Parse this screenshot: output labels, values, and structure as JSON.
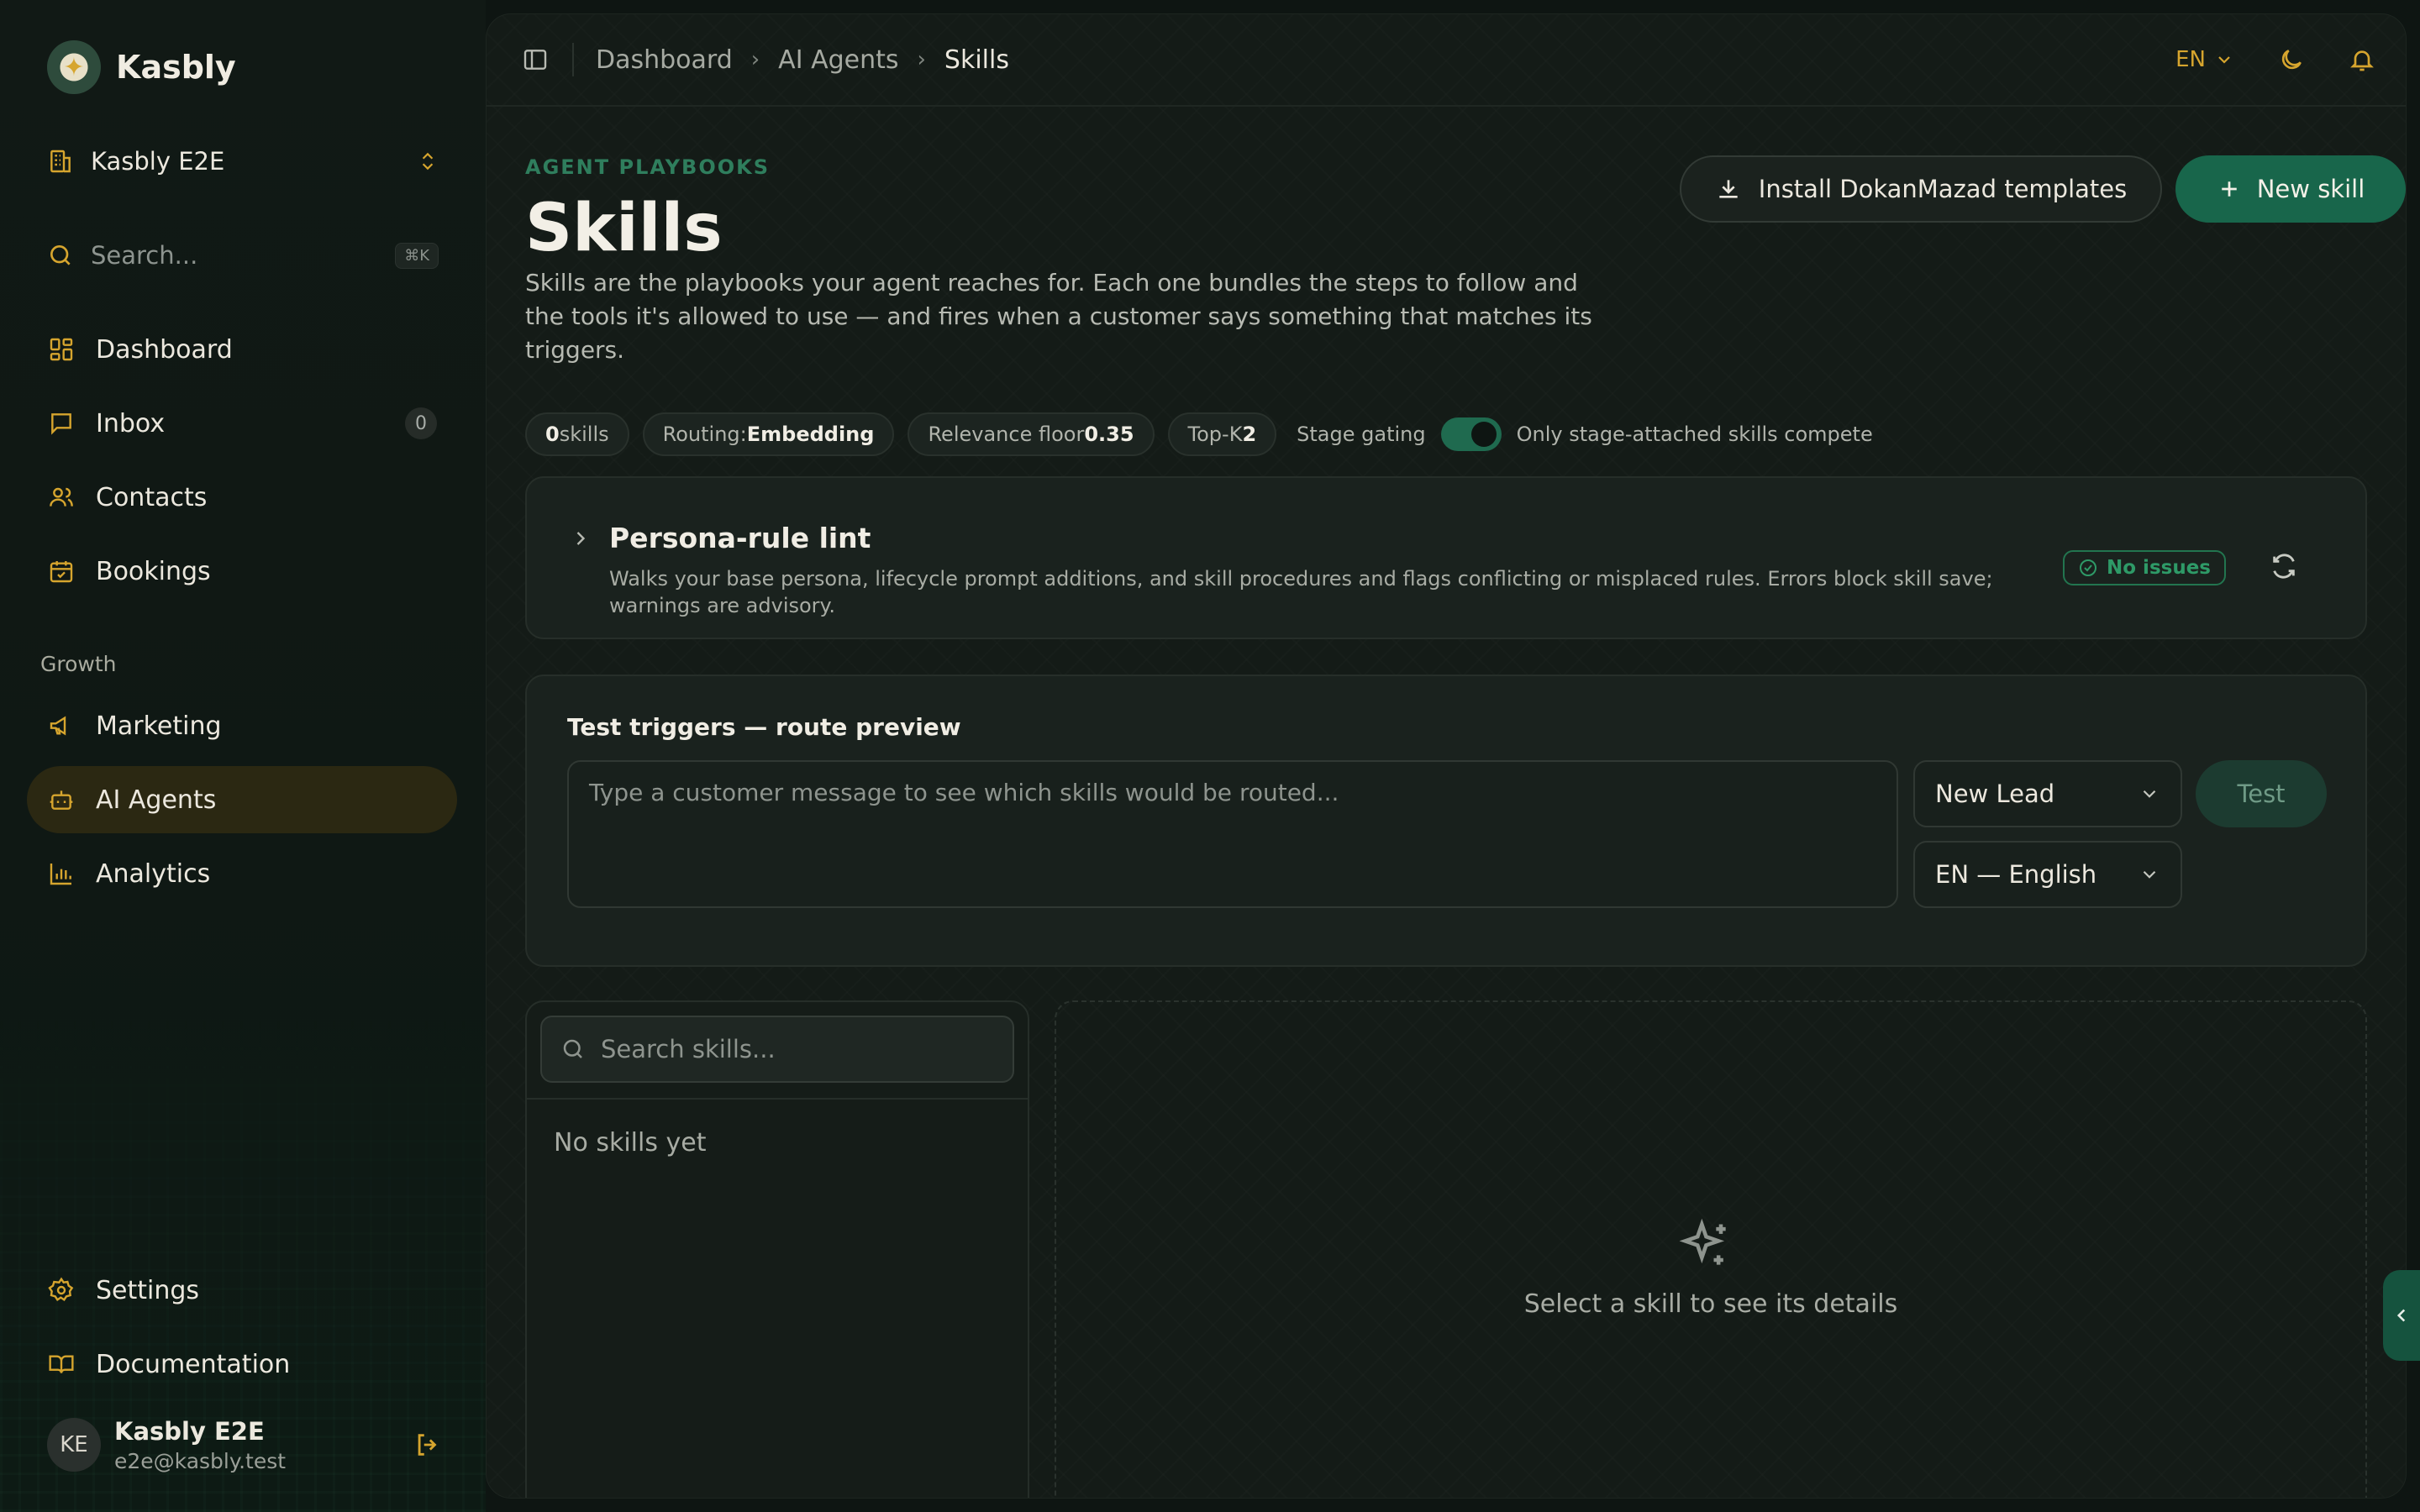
{
  "brand": {
    "name": "Kasbly"
  },
  "org": {
    "name": "Kasbly E2E"
  },
  "sidebar_search": {
    "placeholder": "Search...",
    "shortcut": "⌘K"
  },
  "nav": {
    "dashboard": "Dashboard",
    "inbox": "Inbox",
    "inbox_count": "0",
    "contacts": "Contacts",
    "bookings": "Bookings",
    "growth_label": "Growth",
    "marketing": "Marketing",
    "ai_agents": "AI Agents",
    "analytics": "Analytics",
    "settings": "Settings",
    "documentation": "Documentation"
  },
  "user": {
    "initials": "KE",
    "name": "Kasbly E2E",
    "email": "e2e@kasbly.test"
  },
  "breadcrumb": [
    "Dashboard",
    "AI Agents",
    "Skills"
  ],
  "topbar": {
    "language": "EN"
  },
  "header": {
    "eyebrow": "AGENT PLAYBOOKS",
    "title": "Skills",
    "description": "Skills are the playbooks your agent reaches for. Each one bundles the steps to follow and the tools it's allowed to use — and fires when a customer says something that matches its triggers.",
    "install_button": "Install DokanMazad templates",
    "new_button": "New skill"
  },
  "stats": {
    "skills_count": "0",
    "skills_label": " skills",
    "routing_label": "Routing:",
    "routing_value": "Embedding",
    "relevance_label": "Relevance floor",
    "relevance_value": "0.35",
    "topk_label": "Top-K",
    "topk_value": "2",
    "gating_label": "Stage gating",
    "gating_note": "Only stage-attached skills compete"
  },
  "lint": {
    "title": "Persona-rule lint",
    "description": "Walks your base persona, lifecycle prompt additions, and skill procedures and flags conflicting or misplaced rules. Errors block skill save; warnings are advisory.",
    "status": "No issues"
  },
  "test": {
    "title": "Test triggers — route preview",
    "placeholder": "Type a customer message to see which skills would be routed...",
    "stage_select": "New Lead",
    "language_select": "EN — English",
    "button": "Test"
  },
  "skills_list": {
    "search_placeholder": "Search skills...",
    "empty": "No skills yet"
  },
  "detail": {
    "empty": "Select a skill to see its details"
  },
  "colors": {
    "accent": "#d6a52e",
    "primary": "#18664b",
    "success": "#2e9a67"
  }
}
